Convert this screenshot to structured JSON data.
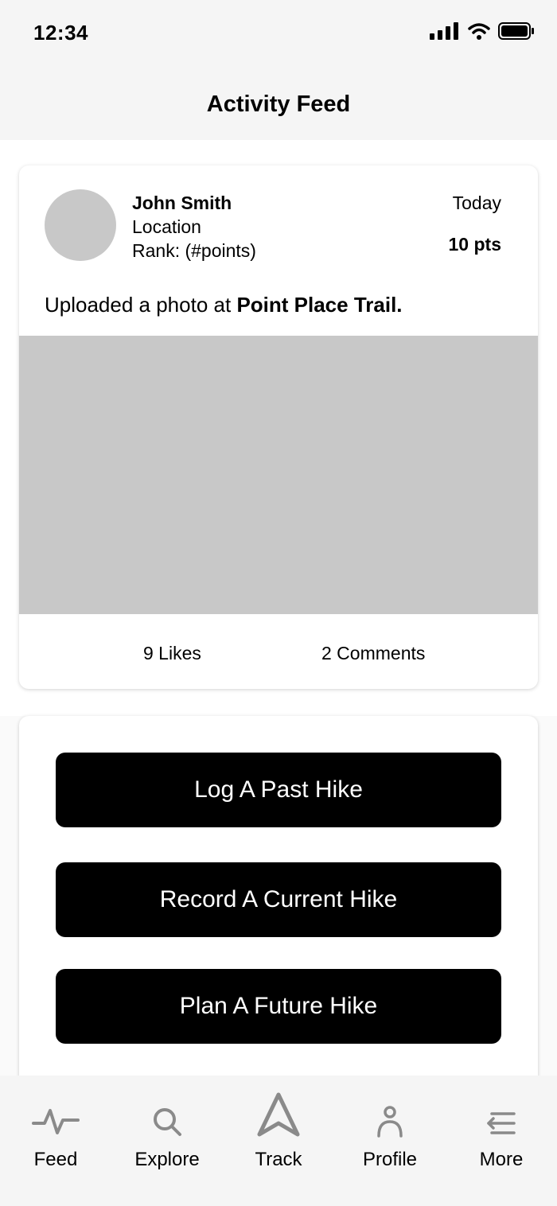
{
  "status_bar": {
    "time": "12:34",
    "icons": [
      "signal-icon",
      "wifi-icon",
      "battery-icon"
    ]
  },
  "header": {
    "title": "Activity Feed"
  },
  "post": {
    "user_name": "John Smith",
    "location": "Location",
    "rank": "Rank: (#points)",
    "date": "Today",
    "points": "10 pts",
    "text_prefix": "Uploaded a photo at",
    "trail_name": "Point Place Trail.",
    "likes": "9 Likes",
    "comments": "2 Comments"
  },
  "actions": {
    "log_past": "Log A Past Hike",
    "record_current": "Record A Current Hike",
    "plan_future": "Plan A Future Hike"
  },
  "tab_bar": {
    "items": [
      {
        "label": "Feed",
        "icon": "activity-icon"
      },
      {
        "label": "Explore",
        "icon": "search-icon"
      },
      {
        "label": "Track",
        "icon": "navigation-arrow-icon"
      },
      {
        "label": "Profile",
        "icon": "person-icon"
      },
      {
        "label": "More",
        "icon": "menu-icon"
      }
    ]
  },
  "colors": {
    "background": "#f5f5f5",
    "card": "#ffffff",
    "placeholder": "#c8c8c8",
    "button": "#000000",
    "button_text": "#ffffff",
    "icon_gray": "#8a8a8a"
  }
}
